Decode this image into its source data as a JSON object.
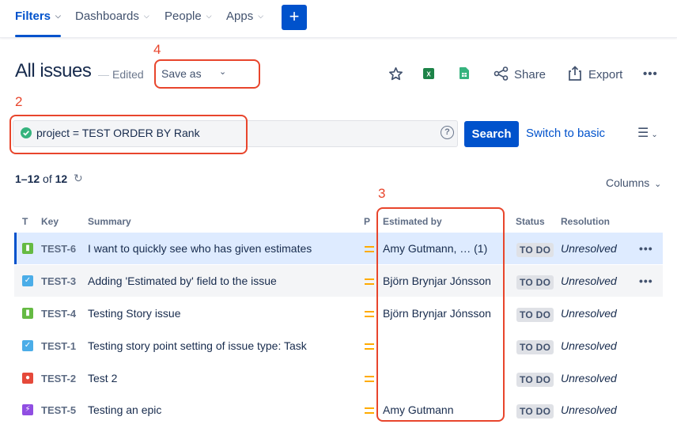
{
  "nav": {
    "filters": "Filters",
    "dashboards": "Dashboards",
    "people": "People",
    "apps": "Apps",
    "create_icon": "+"
  },
  "title_row": {
    "title": "All issues",
    "edited": "Edited",
    "save_as": "Save as",
    "share": "Share",
    "export": "Export"
  },
  "jql": {
    "query": "project = TEST ORDER BY Rank",
    "search_label": "Search",
    "switch_label": "Switch to basic"
  },
  "results": {
    "range": "1–12",
    "of": "of",
    "total": "12",
    "columns_label": "Columns"
  },
  "annotations": [
    "2",
    "3",
    "4"
  ],
  "columns": [
    "T",
    "Key",
    "Summary",
    "P",
    "Estimated by",
    "Status",
    "Resolution"
  ],
  "rows": [
    {
      "type": "story",
      "key": "TEST-6",
      "summary": "I want to quickly see who has given estimates",
      "estimated_by": "Amy Gutmann, … (1)",
      "status": "TO DO",
      "resolution": "Unresolved",
      "more": "•••"
    },
    {
      "type": "task",
      "key": "TEST-3",
      "summary": "Adding 'Estimated by' field to the issue",
      "estimated_by": "Björn Brynjar Jónsson",
      "status": "TO DO",
      "resolution": "Unresolved",
      "more": "•••"
    },
    {
      "type": "story",
      "key": "TEST-4",
      "summary": "Testing Story issue",
      "estimated_by": "Björn Brynjar Jónsson",
      "status": "TO DO",
      "resolution": "Unresolved",
      "more": ""
    },
    {
      "type": "task",
      "key": "TEST-1",
      "summary": "Testing story point setting of issue type: Task",
      "estimated_by": "",
      "status": "TO DO",
      "resolution": "Unresolved",
      "more": ""
    },
    {
      "type": "bug",
      "key": "TEST-2",
      "summary": "Test 2",
      "estimated_by": "",
      "status": "TO DO",
      "resolution": "Unresolved",
      "more": ""
    },
    {
      "type": "epic",
      "key": "TEST-5",
      "summary": "Testing an epic",
      "estimated_by": "Amy Gutmann",
      "status": "TO DO",
      "resolution": "Unresolved",
      "more": ""
    }
  ],
  "colors": {
    "primary": "#0052cc",
    "annotation": "#e8452c",
    "priority_medium": "#ffab00",
    "excel_green": "#1d8348",
    "sheets_green": "#36b37e"
  },
  "icons": {
    "star": "star-icon",
    "excel": "excel-icon",
    "sheets": "google-sheets-icon",
    "share": "share-icon",
    "export": "export-icon"
  }
}
